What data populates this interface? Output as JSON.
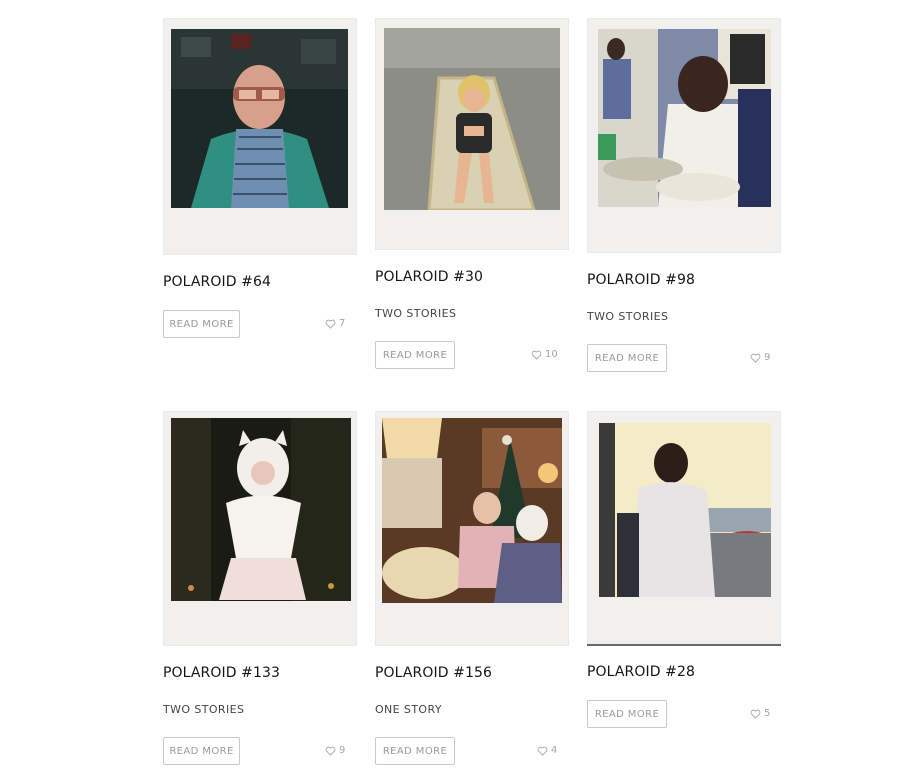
{
  "cards": [
    {
      "title": "POLAROID #64",
      "subtitle": "",
      "button": "READ MORE",
      "likes": "7"
    },
    {
      "title": "POLAROID #30",
      "subtitle": "TWO STORIES",
      "button": "READ MORE",
      "likes": "10"
    },
    {
      "title": "POLAROID #98",
      "subtitle": "TWO STORIES",
      "button": "READ MORE",
      "likes": "9"
    },
    {
      "title": "POLAROID #133",
      "subtitle": "TWO STORIES",
      "button": "READ MORE",
      "likes": "9"
    },
    {
      "title": "POLAROID #156",
      "subtitle": "ONE STORY",
      "button": "READ MORE",
      "likes": "4"
    },
    {
      "title": "POLAROID #28",
      "subtitle": "",
      "button": "READ MORE",
      "likes": "5"
    }
  ],
  "icons": {
    "like": "heart-outline-icon"
  },
  "colors": {
    "polaroid_frame": "#f1f0ee",
    "button_border": "#c9c9c9",
    "muted_text": "#9a9a9a"
  }
}
